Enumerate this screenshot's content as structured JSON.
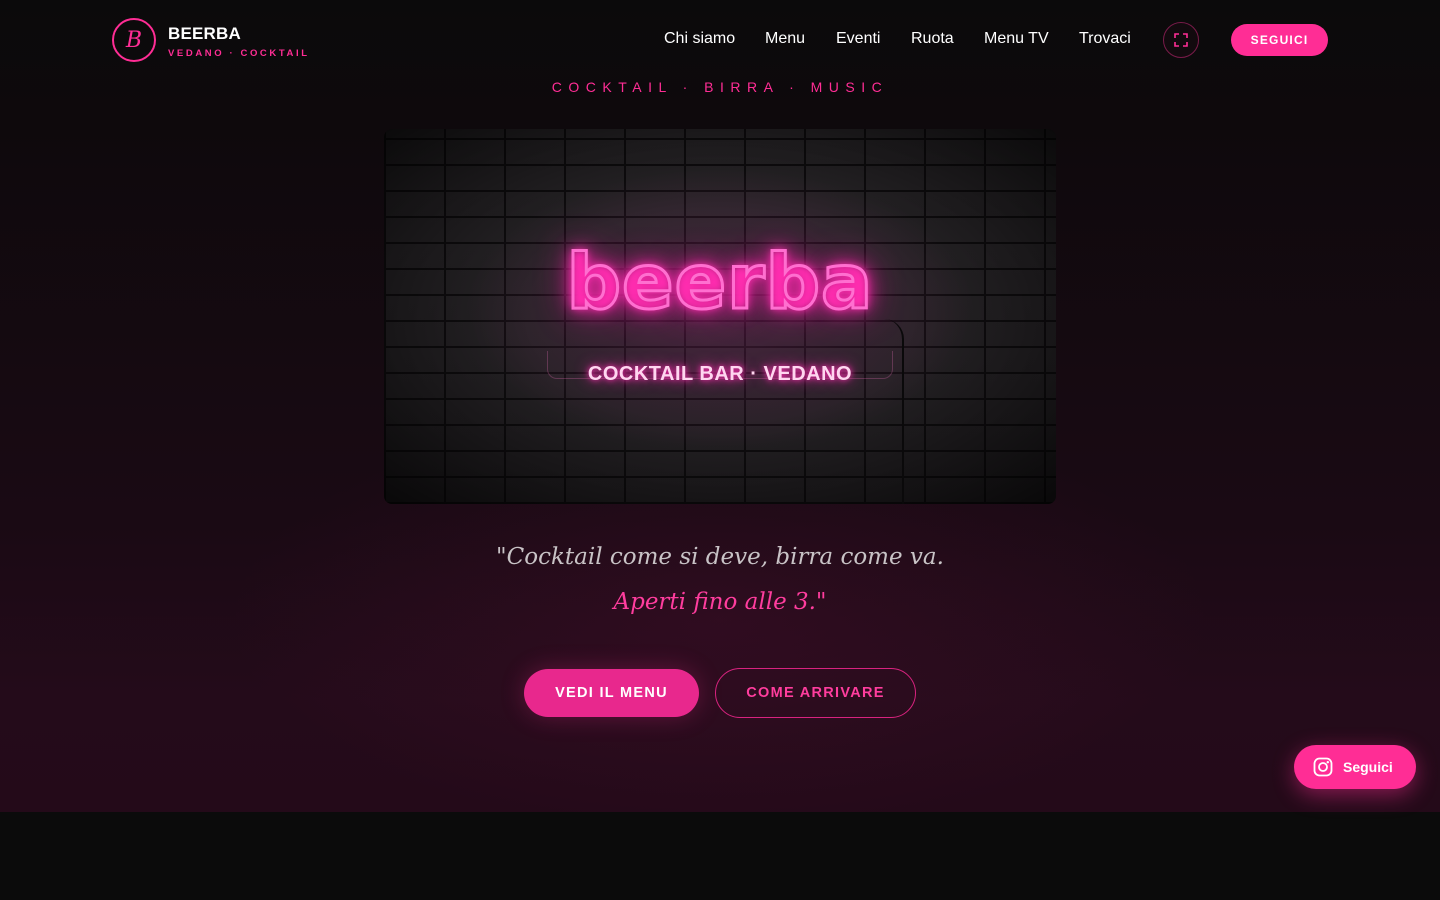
{
  "brand": {
    "logo_letter": "B",
    "name": "BEERBA",
    "subtitle": "VEDANO · COCKTAIL"
  },
  "nav": {
    "items": [
      {
        "label": "Chi siamo"
      },
      {
        "label": "Menu"
      },
      {
        "label": "Eventi"
      },
      {
        "label": "Ruota"
      },
      {
        "label": "Menu TV"
      },
      {
        "label": "Trovaci"
      }
    ],
    "fullscreen_icon": "fullscreen-icon",
    "follow_label": "SEGUICI"
  },
  "hero": {
    "tagline": "COCKTAIL · BIRRA · MUSIC",
    "banner": {
      "neon_word": "beerba",
      "neon_sub": "COCKTAIL BAR · VEDANO"
    },
    "quote_line1": "\"Cocktail come si deve, birra come va.",
    "quote_line2": "Aperti fino alle 3.\"",
    "cta_menu": "VEDI IL MENU",
    "cta_route": "COME ARRIVARE"
  },
  "floating": {
    "icon": "instagram-icon",
    "label": "Seguici"
  },
  "colors": {
    "accent": "#ff2d95",
    "background": "#0b0b0b",
    "hero_bottom": "#240a19"
  }
}
